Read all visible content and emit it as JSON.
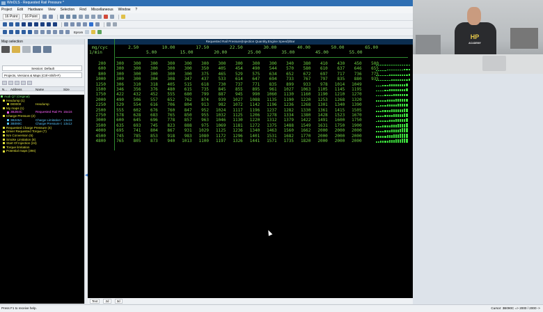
{
  "window": {
    "title": "WinOLS - Requested Rail Pressure *"
  },
  "menu": [
    "Project",
    "Edit",
    "Hardware",
    "View",
    "Selection",
    "Find",
    "Miscellaneous",
    "Window",
    "?"
  ],
  "toolbar": {
    "font1": "16 Point",
    "font2": "16 Point",
    "mode_label": "Eprom"
  },
  "left": {
    "panel_title": "Map selection",
    "session_field": "Session: Default",
    "projects_field": "Projects, Versions & Maps   (Ctrl+Shift+F)",
    "col_name": "N...",
    "col_address": "Address",
    "col_name2": "Name",
    "col_size": "Size"
  },
  "tree": [
    {
      "addr": "Audi Q7 (Original)",
      "name": "",
      "size": "",
      "color": "#6fe36f"
    },
    {
      "addr": "Hexdump (1)",
      "name": "",
      "size": "",
      "color": "#e4e43a"
    },
    {
      "addr": "000000",
      "name": "Hexdump",
      "size": "",
      "color": "#e4e43a"
    },
    {
      "addr": "My maps (1)",
      "name": "",
      "size": "",
      "color": "#e4e43a"
    },
    {
      "addr": "3B2B4C",
      "name": "Requested Rail Pre",
      "size": "15x16",
      "color": "#ff62ff"
    },
    {
      "addr": "Charge Pressure (2)",
      "name": "",
      "size": "",
      "color": "#e4e43a"
    },
    {
      "addr": "3B245A",
      "name": "Charge Limitation Vs",
      "size": "14x16",
      "color": "#59c8ff"
    },
    {
      "addr": "3B090C",
      "name": "Charge Pressure Cal",
      "size": "13x12",
      "color": "#59c8ff"
    },
    {
      "addr": "Requested Charge Pressure (4)",
      "name": "",
      "size": "",
      "color": "#e4e43a"
    },
    {
      "addr": "Driver Requested Torque (7)",
      "name": "",
      "size": "",
      "color": "#e4e43a"
    },
    {
      "addr": "Nm Conversion (5)",
      "name": "",
      "size": "",
      "color": "#e4e43a"
    },
    {
      "addr": "Smoke Limitation (8)",
      "name": "",
      "size": "",
      "color": "#e4e43a"
    },
    {
      "addr": "Start Of Injection (24)",
      "name": "",
      "size": "",
      "color": "#e4e43a"
    },
    {
      "addr": "Torque limitation",
      "name": "",
      "size": "",
      "color": "#e4e43a"
    },
    {
      "addr": "Potential maps (394)",
      "name": "",
      "size": "",
      "color": "#e4e43a"
    }
  ],
  "map": {
    "header": "Requested Rail Pressure(Injection Quantity,Engine Speed)/Bar",
    "y_unit": "mg/cyc",
    "x_unit": "1/min",
    "columns_row1": [
      "2.50",
      "10.00",
      "17.50",
      "22.50",
      "30.00",
      "40.00",
      "50.00",
      "65.00"
    ],
    "columns_row2": [
      "5.00",
      "15.00",
      "20.00",
      "25.00",
      "35.00",
      "45.00",
      "55.00"
    ],
    "rpm": [
      "200",
      "600",
      "800",
      "1000",
      "1250",
      "1500",
      "1750",
      "2000",
      "2250",
      "2500",
      "2750",
      "3000",
      "3500",
      "4000",
      "4500",
      "4800"
    ],
    "values": [
      [
        300,
        300,
        300,
        300,
        300,
        300,
        300,
        300,
        300,
        300,
        340,
        380,
        410,
        430,
        450,
        500
      ],
      [
        300,
        300,
        300,
        300,
        300,
        350,
        405,
        454,
        490,
        544,
        570,
        580,
        610,
        637,
        646,
        655
      ],
      [
        300,
        300,
        300,
        300,
        300,
        375,
        465,
        529,
        575,
        634,
        652,
        672,
        697,
        717,
        736,
        775
      ],
      [
        300,
        300,
        304,
        308,
        347,
        437,
        533,
        614,
        647,
        694,
        733,
        767,
        797,
        835,
        880,
        935
      ],
      [
        306,
        310,
        318,
        405,
        515,
        618,
        730,
        737,
        771,
        835,
        899,
        933,
        978,
        1014,
        1049,
        ""
      ],
      [
        346,
        356,
        376,
        480,
        615,
        735,
        845,
        855,
        895,
        961,
        1027,
        1063,
        1105,
        1145,
        1195,
        ""
      ],
      [
        422,
        432,
        452,
        555,
        680,
        799,
        887,
        945,
        990,
        1060,
        1130,
        1160,
        1190,
        1210,
        1270,
        ""
      ],
      [
        490,
        506,
        557,
        652,
        762,
        874,
        939,
        1027,
        1088,
        1135,
        1190,
        1220,
        1253,
        1268,
        1320,
        ""
      ],
      [
        529,
        554,
        616,
        706,
        804,
        913,
        982,
        1072,
        1142,
        1196,
        1236,
        1268,
        1301,
        1340,
        1390,
        ""
      ],
      [
        555,
        602,
        676,
        760,
        847,
        952,
        1024,
        1117,
        1196,
        1237,
        1282,
        1330,
        1361,
        1415,
        1505,
        ""
      ],
      [
        578,
        628,
        683,
        765,
        850,
        955,
        1032,
        1125,
        1206,
        1278,
        1334,
        1380,
        1428,
        1523,
        1670,
        ""
      ],
      [
        600,
        645,
        696,
        778,
        857,
        963,
        1046,
        1130,
        1220,
        1312,
        1379,
        1422,
        1491,
        1600,
        1750,
        ""
      ],
      [
        635,
        693,
        745,
        823,
        888,
        975,
        1069,
        1181,
        1272,
        1375,
        1488,
        1549,
        1631,
        1750,
        1900,
        ""
      ],
      [
        695,
        741,
        804,
        867,
        931,
        1029,
        1125,
        1236,
        1340,
        1463,
        1560,
        1662,
        2000,
        2000,
        2000,
        ""
      ],
      [
        745,
        785,
        853,
        918,
        983,
        1080,
        1172,
        1296,
        1401,
        1531,
        1682,
        1770,
        2000,
        2000,
        2000,
        ""
      ],
      [
        765,
        805,
        873,
        940,
        1013,
        1100,
        1197,
        1326,
        1441,
        1571,
        1735,
        1820,
        2000,
        2000,
        2000,
        ""
      ]
    ]
  },
  "bottom_tabs": [
    "Text",
    "2d",
    "3d"
  ],
  "status": {
    "left": "Press F1 to receive help.",
    "right": "Cursor: 3B090C => 2000 / 2000 ->"
  },
  "colors": {
    "title_bar": "#2f6fb3",
    "map_text": "#6fd040",
    "map_bg": "#000000"
  }
}
